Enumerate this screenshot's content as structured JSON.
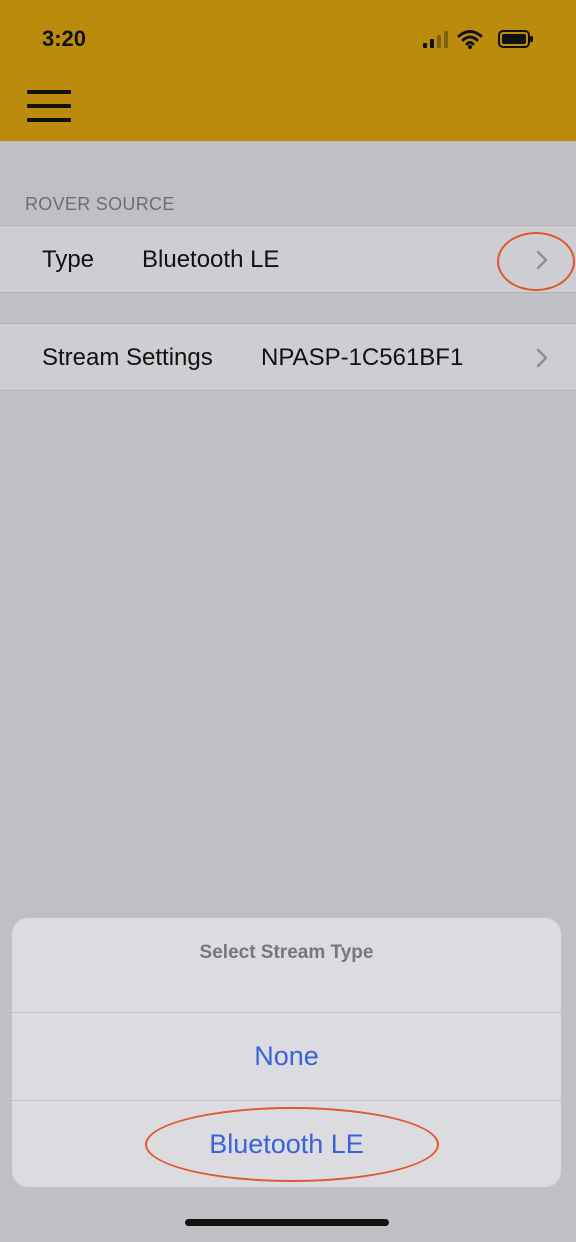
{
  "status_bar": {
    "time": "3:20"
  },
  "section": {
    "header": "ROVER SOURCE"
  },
  "rows": [
    {
      "label": "Type",
      "value": "Bluetooth LE"
    },
    {
      "label": "Stream Settings",
      "value": "NPASP-1C561BF1"
    }
  ],
  "action_sheet": {
    "title": "Select Stream Type",
    "options": [
      "None",
      "Bluetooth LE"
    ]
  },
  "colors": {
    "top_bar": "#bb8b0c",
    "action_text": "#3a63d8",
    "annotation": "#e0562d",
    "background": "#c0bfc4"
  },
  "icons": [
    "cellular-signal-icon",
    "wifi-icon",
    "battery-icon",
    "hamburger-menu-icon",
    "chevron-right-icon"
  ]
}
